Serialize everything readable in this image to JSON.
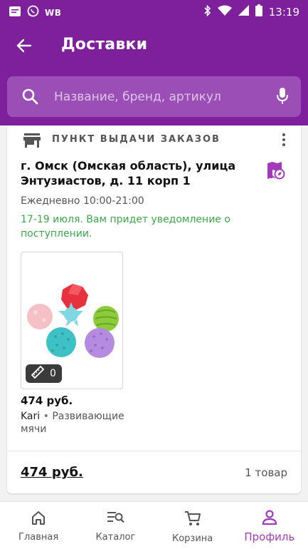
{
  "status_bar": {
    "carrier_label": "WB",
    "time": "13:19",
    "icons": [
      "notification-icon",
      "whatsapp-icon",
      "bluetooth-icon",
      "wifi-icon",
      "signal-icon",
      "battery-icon"
    ]
  },
  "header": {
    "title": "Доставки",
    "back_icon": "arrow-left-icon"
  },
  "search": {
    "placeholder": "Название, бренд, артикул",
    "value": ""
  },
  "pickup": {
    "type_label": "ПУНКТ ВЫДАЧИ ЗАКАЗОВ",
    "address": "г. Омск (Омская область), улица Энтузиастов, д. 11 корп 1",
    "hours": "Ежедневно 10:00-21:00",
    "delivery_note": "17-19 июля. Вам придет уведомление о поступлении."
  },
  "product": {
    "size_count": "0",
    "price": "474 руб.",
    "brand": "Kari",
    "separator": "•",
    "category": "Развивающие мячи"
  },
  "summary": {
    "total": "474 руб.",
    "count": "1 товар"
  },
  "nav": {
    "items": [
      {
        "label": "Главная",
        "icon": "home-icon"
      },
      {
        "label": "Каталог",
        "icon": "catalog-search-icon"
      },
      {
        "label": "Корзина",
        "icon": "cart-icon"
      },
      {
        "label": "Профиль",
        "icon": "profile-icon"
      }
    ],
    "active_index": 3
  },
  "colors": {
    "brand": "#7e1f9c",
    "search_bg": "#9b4fb6",
    "accent": "#a23bbb",
    "delivery_green": "#3ba64a"
  }
}
